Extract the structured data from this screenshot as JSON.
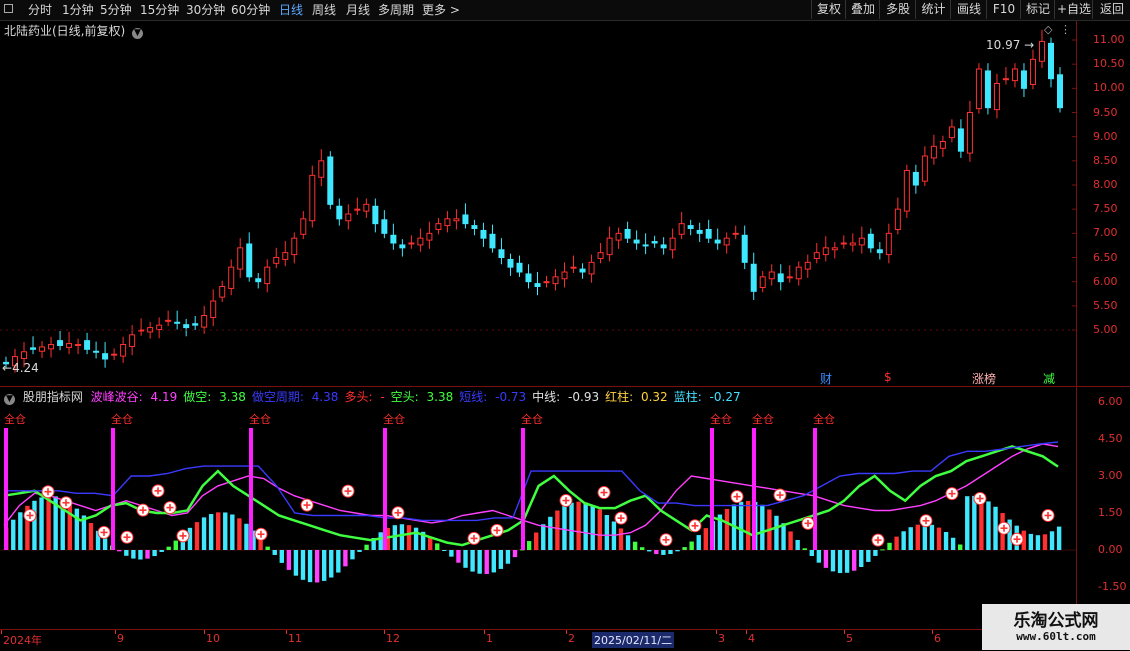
{
  "toolbar": {
    "periods": [
      "分时",
      "1分钟",
      "5分钟",
      "15分钟",
      "30分钟",
      "60分钟",
      "日线",
      "周线",
      "月线",
      "多周期",
      "更多 >"
    ],
    "active_period": "日线",
    "buttons": [
      "复权",
      "叠加",
      "多股",
      "统计",
      "画线",
      "F10",
      "标记",
      "+自选",
      "返回"
    ]
  },
  "main_panel": {
    "title": "北陆药业(日线,前复权)",
    "high_label": "10.97",
    "low_label": "4.24",
    "y_ticks": [
      "11.00",
      "10.50",
      "10.00",
      "9.50",
      "9.00",
      "8.50",
      "8.00",
      "7.50",
      "7.00",
      "6.50",
      "6.00",
      "5.50",
      "5.00"
    ],
    "markers": [
      {
        "text": "财",
        "color": "#3a8bff"
      },
      {
        "text": "$",
        "color": "#ff3030"
      },
      {
        "text": "涨榜",
        "color": "#ffb0b0"
      },
      {
        "text": "减",
        "color": "#40ff40"
      }
    ]
  },
  "indicator_panel": {
    "name": "股朋指标网",
    "readouts": [
      {
        "label": "波峰波谷:",
        "value": "4.19",
        "color": "#ff40ff"
      },
      {
        "label": "做空:",
        "value": "3.38",
        "color": "#40ff40"
      },
      {
        "label": "做空周期:",
        "value": "4.38",
        "color": "#3a3aff"
      },
      {
        "label": "多头:",
        "value": "-",
        "color": "#ff3030"
      },
      {
        "label": "空头:",
        "value": "3.38",
        "color": "#40ff40"
      },
      {
        "label": "短线:",
        "value": "-0.73",
        "color": "#3a3aff"
      },
      {
        "label": "中线:",
        "value": "-0.93",
        "color": "#e0e0e0"
      },
      {
        "label": "红柱:",
        "value": "0.32",
        "color": "#ffd040"
      },
      {
        "label": "蓝柱:",
        "value": "-0.27",
        "color": "#40e0ff"
      }
    ],
    "y_ticks": [
      "6.00",
      "4.50",
      "3.00",
      "1.50",
      "0.00",
      "-1.50"
    ],
    "signal_label": "全仓"
  },
  "date_axis": {
    "labels": [
      "2024年",
      "9",
      "10",
      "11",
      "12",
      "1",
      "2",
      "2025/02/11/二",
      "3",
      "4",
      "5",
      "6"
    ],
    "highlight": "2025/02/11/二"
  },
  "watermark": {
    "title": "乐淘公式网",
    "url": "www.60lt.com"
  },
  "colors": {
    "up": "#ff3030",
    "down": "#40e8ff",
    "axis": "#e03030"
  },
  "chart_data": [
    {
      "type": "candlestick",
      "title": "北陆药业(日线,前复权)",
      "ylim": [
        4.6,
        11.3
      ],
      "close": [
        4.3,
        4.45,
        4.55,
        4.6,
        4.65,
        4.7,
        4.68,
        4.72,
        4.7,
        4.6,
        4.55,
        4.4,
        4.5,
        4.7,
        4.9,
        5.0,
        5.05,
        5.1,
        5.2,
        5.15,
        5.05,
        5.1,
        5.3,
        5.6,
        5.9,
        6.3,
        6.7,
        6.1,
        6.0,
        6.3,
        6.5,
        6.6,
        6.9,
        7.3,
        8.2,
        8.5,
        7.6,
        7.3,
        7.4,
        7.5,
        7.6,
        7.2,
        7.0,
        6.8,
        6.7,
        6.8,
        6.9,
        7.0,
        7.2,
        7.3,
        7.3,
        7.2,
        7.1,
        6.9,
        6.7,
        6.5,
        6.3,
        6.2,
        6.0,
        5.9,
        6.0,
        6.1,
        6.2,
        6.3,
        6.2,
        6.4,
        6.6,
        6.9,
        7.0,
        6.9,
        6.8,
        6.75,
        6.8,
        6.7,
        6.9,
        7.2,
        7.1,
        7.0,
        6.9,
        6.8,
        6.9,
        7.0,
        6.4,
        5.8,
        6.1,
        6.2,
        6.0,
        6.1,
        6.3,
        6.4,
        6.6,
        6.7,
        6.7,
        6.8,
        6.8,
        6.9,
        6.7,
        6.6,
        7.0,
        7.5,
        8.3,
        8.0,
        8.6,
        8.8,
        8.9,
        9.2,
        8.7,
        9.5,
        10.4,
        9.6,
        10.1,
        10.2,
        10.4,
        10.0,
        10.6,
        10.97,
        10.2,
        9.6
      ],
      "high_label": 10.97,
      "low_label": 4.24
    },
    {
      "type": "line",
      "title": "股朋指标网",
      "ylim": [
        -2.0,
        6.6
      ],
      "series": [
        {
          "name": "波峰波谷",
          "color": "#ff40ff",
          "values": [
            1.0,
            1.8,
            2.3,
            2.2,
            2.0,
            1.8,
            1.6,
            1.8,
            2.0,
            1.8,
            1.6,
            1.4,
            1.5,
            2.2,
            2.6,
            2.8,
            3.0,
            2.9,
            2.5,
            2.2,
            2.0,
            1.8,
            1.6,
            1.5,
            1.4,
            1.4,
            1.3,
            1.2,
            1.1,
            1.2,
            1.4,
            1.5,
            1.6,
            1.4,
            1.2,
            1.0,
            0.9,
            0.8,
            0.7,
            0.6,
            0.6,
            0.7,
            1.0,
            1.6,
            2.4,
            3.0,
            2.9,
            2.8,
            2.7,
            2.6,
            2.5,
            2.4,
            2.3,
            2.2,
            2.0,
            1.8,
            1.7,
            1.6,
            1.6,
            1.7,
            1.8,
            2.0,
            2.3,
            2.6,
            3.0,
            3.4,
            3.8,
            4.1,
            4.3,
            4.19
          ]
        },
        {
          "name": "做空",
          "color": "#40ff40",
          "values": [
            2.2,
            2.3,
            2.4,
            2.0,
            1.6,
            1.2,
            1.4,
            1.8,
            1.9,
            1.6,
            1.5,
            1.5,
            1.6,
            2.6,
            3.2,
            2.6,
            2.2,
            1.8,
            1.4,
            1.2,
            1.0,
            0.8,
            0.6,
            0.5,
            0.4,
            0.5,
            0.6,
            0.7,
            0.5,
            0.3,
            0.2,
            0.4,
            0.6,
            0.8,
            1.2,
            2.6,
            3.0,
            2.4,
            1.9,
            1.7,
            1.7,
            2.0,
            2.2,
            1.6,
            1.2,
            0.8,
            1.4,
            1.2,
            0.9,
            0.6,
            0.8,
            1.0,
            1.2,
            1.4,
            1.6,
            2.0,
            2.6,
            3.0,
            2.4,
            2.0,
            2.6,
            3.0,
            3.2,
            3.6,
            3.8,
            4.0,
            4.2,
            4.0,
            3.8,
            3.38
          ]
        },
        {
          "name": "做空周期",
          "color": "#3a3aff",
          "values": [
            2.4,
            2.4,
            2.4,
            2.4,
            2.3,
            2.3,
            2.2,
            3.0,
            3.0,
            3.1,
            3.3,
            3.4,
            3.4,
            3.4,
            3.4,
            2.6,
            1.5,
            1.4,
            1.4,
            1.4,
            1.4,
            1.3,
            1.3,
            1.2,
            1.2,
            1.2,
            1.2,
            1.3,
            1.3,
            3.2,
            3.2,
            3.2,
            3.2,
            3.2,
            3.2,
            2.4,
            1.9,
            1.9,
            1.8,
            1.8,
            1.8,
            1.8,
            1.8,
            2.0,
            2.2,
            2.6,
            3.0,
            3.1,
            3.1,
            3.1,
            3.2,
            3.2,
            3.8,
            4.0,
            4.0,
            4.1,
            4.2,
            4.3,
            4.38
          ]
        }
      ]
    }
  ]
}
